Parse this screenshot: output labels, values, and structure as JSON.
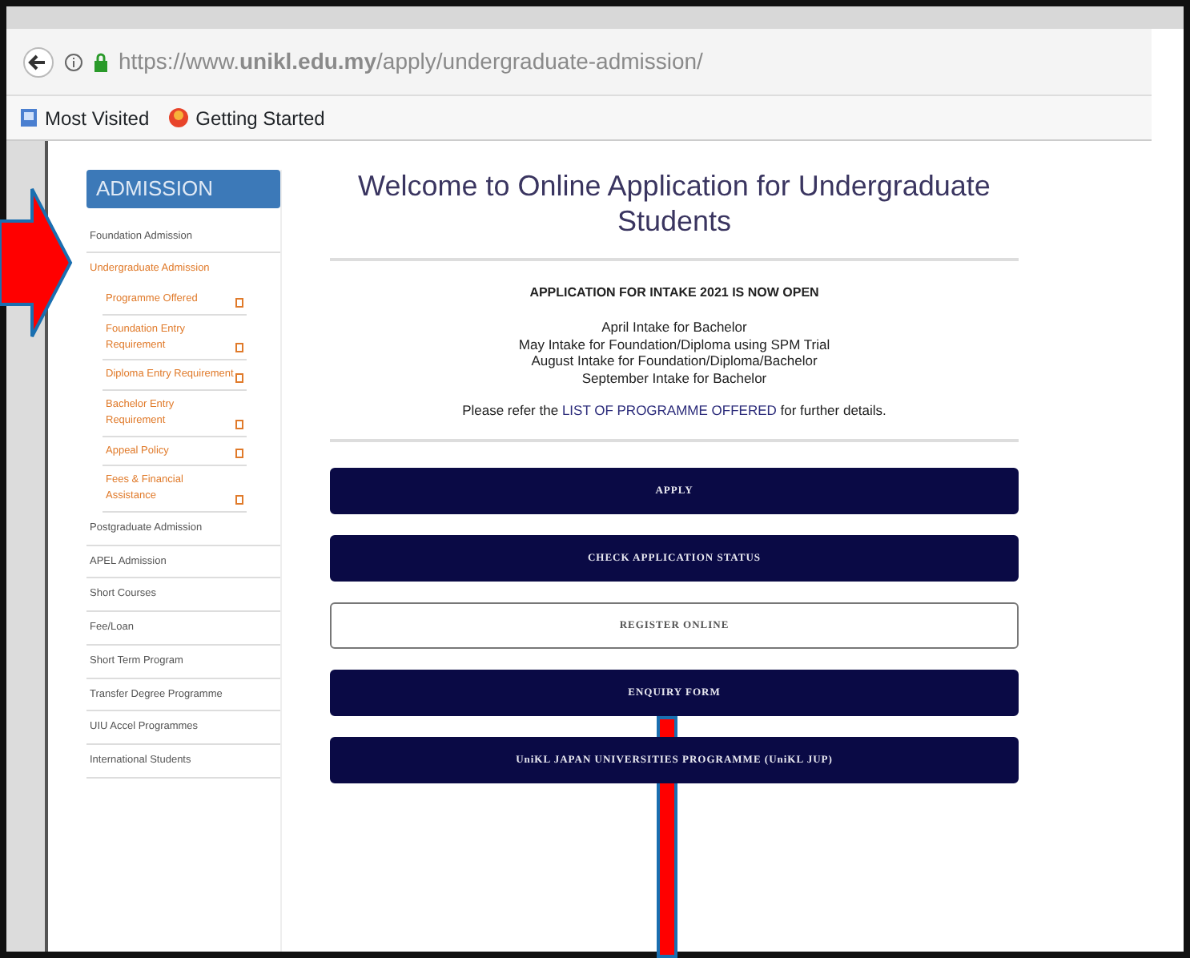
{
  "browser": {
    "url": "https://www.**unikl.edu.my**/apply/undergraduate-admission/",
    "bookmarks": [
      {
        "label": "Most Visited",
        "kind": "folder"
      },
      {
        "label": "Getting Started",
        "kind": "globe"
      }
    ]
  },
  "sidebar": {
    "title": "ADMISSION",
    "items": [
      {
        "label": "Foundation Admission",
        "expanded": false
      },
      {
        "label": "Undergraduate Admission",
        "expanded": true,
        "children": [
          {
            "label": "Programme Offered"
          },
          {
            "label": "Foundation Entry Requirement"
          },
          {
            "label": "Diploma Entry Requirement"
          },
          {
            "label": "Bachelor Entry Requirement"
          },
          {
            "label": "Appeal Policy"
          },
          {
            "label": "Fees & Financial Assistance"
          }
        ]
      },
      {
        "label": "Postgraduate Admission",
        "expanded": false
      },
      {
        "label": "APEL Admission",
        "expanded": false
      },
      {
        "label": "Short Courses",
        "expanded": false
      },
      {
        "label": "Fee/Loan",
        "expanded": false
      },
      {
        "label": "Short Term Program",
        "expanded": false
      },
      {
        "label": "Transfer Degree Programme",
        "expanded": false
      },
      {
        "label": "UIU Accel Programmes",
        "expanded": false
      },
      {
        "label": "International Students",
        "expanded": false
      }
    ]
  },
  "main": {
    "title": "Welcome to Online Application for Undergraduate Students",
    "announcement": "APPLICATION FOR INTAKE 2021 IS NOW OPEN",
    "intakes": [
      "April Intake for Bachelor",
      "May Intake for Foundation/Diploma using SPM Trial",
      "August Intake for Foundation/Diploma/Bachelor",
      "September Intake for Bachelor"
    ],
    "note_before": "Please refer the",
    "note_link": "LIST OF PROGRAMME OFFERED",
    "note_after": "for further details."
  },
  "buttons": [
    {
      "label": "APPLY",
      "kind": "filled"
    },
    {
      "label": "CHECK APPLICATION STATUS",
      "kind": "filled"
    },
    {
      "label": "REGISTER ONLINE",
      "kind": "outline"
    },
    {
      "label": "ENQUIRY FORM",
      "kind": "filled"
    },
    {
      "label": "UniKL JAPAN UNIVERSITIES PROGRAMME (UniKL JUP)",
      "kind": "filled"
    }
  ]
}
